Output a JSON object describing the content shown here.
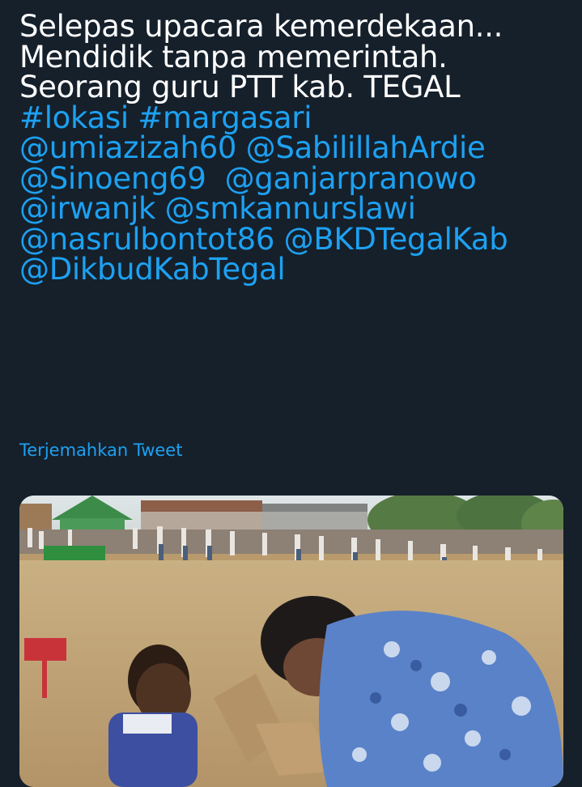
{
  "tweet": {
    "lines": [
      [
        {
          "text": "Selepas upacara kemerdekaan...",
          "kind": "plain"
        }
      ],
      [
        {
          "text": "Mendidik tanpa memerintah.",
          "kind": "plain"
        }
      ],
      [
        {
          "text": "Seorang guru PTT kab. TEGAL",
          "kind": "plain"
        }
      ],
      [
        {
          "text": "#lokasi",
          "kind": "link"
        },
        {
          "text": " ",
          "kind": "plain"
        },
        {
          "text": "#margasari",
          "kind": "link"
        }
      ],
      [
        {
          "text": "@umiazizah60",
          "kind": "link"
        },
        {
          "text": " ",
          "kind": "plain"
        },
        {
          "text": "@SabilillahArdie",
          "kind": "link"
        }
      ],
      [
        {
          "text": "@Sinoeng69",
          "kind": "link"
        },
        {
          "text": "  ",
          "kind": "plain"
        },
        {
          "text": "@ganjarpranowo",
          "kind": "link"
        }
      ],
      [
        {
          "text": "@irwanjk",
          "kind": "link"
        },
        {
          "text": " ",
          "kind": "plain"
        },
        {
          "text": "@smkannurslawi",
          "kind": "link"
        }
      ],
      [
        {
          "text": "@nasrulbontot86",
          "kind": "link"
        },
        {
          "text": " ",
          "kind": "plain"
        },
        {
          "text": "@BKDTegalKab",
          "kind": "link"
        }
      ],
      [
        {
          "text": "@DikbudKabTegal",
          "kind": "link"
        }
      ]
    ]
  },
  "translate_label": "Terjemahkan Tweet",
  "media": {
    "description_icon": "video-thumbnail"
  },
  "colors": {
    "background": "#15202b",
    "text": "#ffffff",
    "link": "#1da1f2"
  }
}
